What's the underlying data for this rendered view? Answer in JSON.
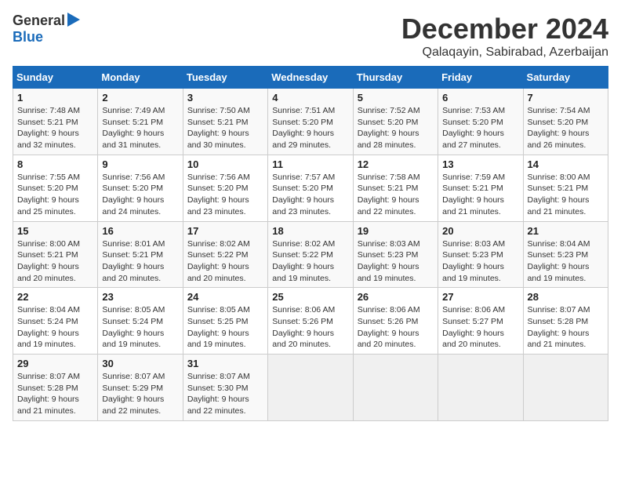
{
  "header": {
    "logo_general": "General",
    "logo_blue": "Blue",
    "month_title": "December 2024",
    "location": "Qalaqayin, Sabirabad, Azerbaijan"
  },
  "days_of_week": [
    "Sunday",
    "Monday",
    "Tuesday",
    "Wednesday",
    "Thursday",
    "Friday",
    "Saturday"
  ],
  "weeks": [
    [
      {
        "day": "1",
        "sunrise": "7:48 AM",
        "sunset": "5:21 PM",
        "daylight": "9 hours and 32 minutes."
      },
      {
        "day": "2",
        "sunrise": "7:49 AM",
        "sunset": "5:21 PM",
        "daylight": "9 hours and 31 minutes."
      },
      {
        "day": "3",
        "sunrise": "7:50 AM",
        "sunset": "5:21 PM",
        "daylight": "9 hours and 30 minutes."
      },
      {
        "day": "4",
        "sunrise": "7:51 AM",
        "sunset": "5:20 PM",
        "daylight": "9 hours and 29 minutes."
      },
      {
        "day": "5",
        "sunrise": "7:52 AM",
        "sunset": "5:20 PM",
        "daylight": "9 hours and 28 minutes."
      },
      {
        "day": "6",
        "sunrise": "7:53 AM",
        "sunset": "5:20 PM",
        "daylight": "9 hours and 27 minutes."
      },
      {
        "day": "7",
        "sunrise": "7:54 AM",
        "sunset": "5:20 PM",
        "daylight": "9 hours and 26 minutes."
      }
    ],
    [
      {
        "day": "8",
        "sunrise": "7:55 AM",
        "sunset": "5:20 PM",
        "daylight": "9 hours and 25 minutes."
      },
      {
        "day": "9",
        "sunrise": "7:56 AM",
        "sunset": "5:20 PM",
        "daylight": "9 hours and 24 minutes."
      },
      {
        "day": "10",
        "sunrise": "7:56 AM",
        "sunset": "5:20 PM",
        "daylight": "9 hours and 23 minutes."
      },
      {
        "day": "11",
        "sunrise": "7:57 AM",
        "sunset": "5:20 PM",
        "daylight": "9 hours and 23 minutes."
      },
      {
        "day": "12",
        "sunrise": "7:58 AM",
        "sunset": "5:21 PM",
        "daylight": "9 hours and 22 minutes."
      },
      {
        "day": "13",
        "sunrise": "7:59 AM",
        "sunset": "5:21 PM",
        "daylight": "9 hours and 21 minutes."
      },
      {
        "day": "14",
        "sunrise": "8:00 AM",
        "sunset": "5:21 PM",
        "daylight": "9 hours and 21 minutes."
      }
    ],
    [
      {
        "day": "15",
        "sunrise": "8:00 AM",
        "sunset": "5:21 PM",
        "daylight": "9 hours and 20 minutes."
      },
      {
        "day": "16",
        "sunrise": "8:01 AM",
        "sunset": "5:21 PM",
        "daylight": "9 hours and 20 minutes."
      },
      {
        "day": "17",
        "sunrise": "8:02 AM",
        "sunset": "5:22 PM",
        "daylight": "9 hours and 20 minutes."
      },
      {
        "day": "18",
        "sunrise": "8:02 AM",
        "sunset": "5:22 PM",
        "daylight": "9 hours and 19 minutes."
      },
      {
        "day": "19",
        "sunrise": "8:03 AM",
        "sunset": "5:23 PM",
        "daylight": "9 hours and 19 minutes."
      },
      {
        "day": "20",
        "sunrise": "8:03 AM",
        "sunset": "5:23 PM",
        "daylight": "9 hours and 19 minutes."
      },
      {
        "day": "21",
        "sunrise": "8:04 AM",
        "sunset": "5:23 PM",
        "daylight": "9 hours and 19 minutes."
      }
    ],
    [
      {
        "day": "22",
        "sunrise": "8:04 AM",
        "sunset": "5:24 PM",
        "daylight": "9 hours and 19 minutes."
      },
      {
        "day": "23",
        "sunrise": "8:05 AM",
        "sunset": "5:24 PM",
        "daylight": "9 hours and 19 minutes."
      },
      {
        "day": "24",
        "sunrise": "8:05 AM",
        "sunset": "5:25 PM",
        "daylight": "9 hours and 19 minutes."
      },
      {
        "day": "25",
        "sunrise": "8:06 AM",
        "sunset": "5:26 PM",
        "daylight": "9 hours and 20 minutes."
      },
      {
        "day": "26",
        "sunrise": "8:06 AM",
        "sunset": "5:26 PM",
        "daylight": "9 hours and 20 minutes."
      },
      {
        "day": "27",
        "sunrise": "8:06 AM",
        "sunset": "5:27 PM",
        "daylight": "9 hours and 20 minutes."
      },
      {
        "day": "28",
        "sunrise": "8:07 AM",
        "sunset": "5:28 PM",
        "daylight": "9 hours and 21 minutes."
      }
    ],
    [
      {
        "day": "29",
        "sunrise": "8:07 AM",
        "sunset": "5:28 PM",
        "daylight": "9 hours and 21 minutes."
      },
      {
        "day": "30",
        "sunrise": "8:07 AM",
        "sunset": "5:29 PM",
        "daylight": "9 hours and 22 minutes."
      },
      {
        "day": "31",
        "sunrise": "8:07 AM",
        "sunset": "5:30 PM",
        "daylight": "9 hours and 22 minutes."
      },
      null,
      null,
      null,
      null
    ]
  ],
  "labels": {
    "sunrise": "Sunrise:",
    "sunset": "Sunset:",
    "daylight": "Daylight:"
  }
}
